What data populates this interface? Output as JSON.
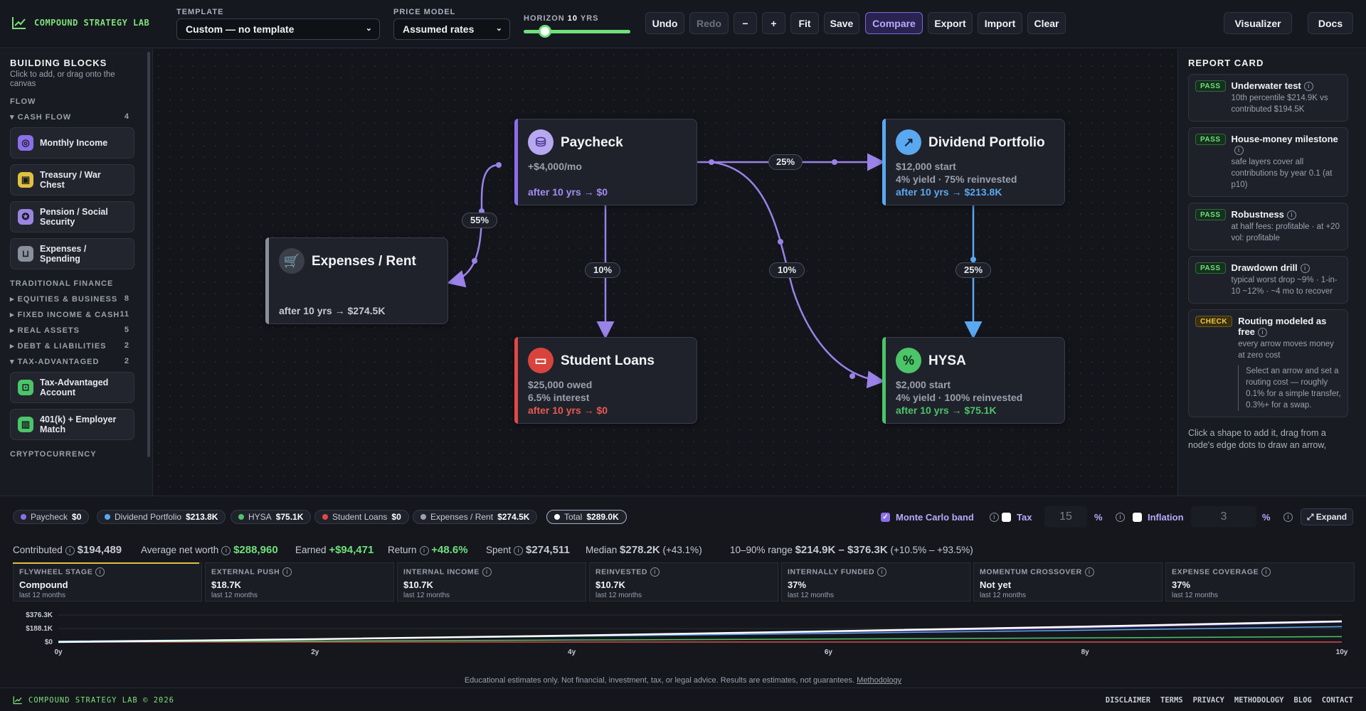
{
  "app": {
    "brand": "COMPOUND STRATEGY LAB"
  },
  "toolbar": {
    "template_label": "TEMPLATE",
    "template_value": "Custom — no template",
    "price_label": "PRICE MODEL",
    "price_value": "Assumed rates",
    "horizon_label": "HORIZON",
    "horizon_value": "10",
    "horizon_unit": "YRS",
    "horizon_fraction": 0.2,
    "buttons": [
      "Undo",
      "Redo",
      "−",
      "+",
      "Fit",
      "Save",
      "Compare",
      "Export",
      "Import",
      "Clear"
    ],
    "visualizer": "Visualizer",
    "docs": "Docs"
  },
  "sidebar": {
    "title": "BUILDING BLOCKS",
    "subtitle": "Click to add, or drag onto the canvas",
    "flow": "FLOW",
    "cash_flow": {
      "label": "CASH FLOW",
      "count": "4"
    },
    "blocks": [
      {
        "label": "Monthly Income",
        "icon": "coin-stack-icon",
        "color": "#8b6fe8"
      },
      {
        "label": "Treasury / War Chest",
        "icon": "safe-icon",
        "color": "#e0c040"
      },
      {
        "label": "Pension / Social Security",
        "icon": "award-icon",
        "color": "#9a86e0"
      },
      {
        "label": "Expenses / Spending",
        "icon": "cart-icon",
        "color": "#8a8f9c"
      }
    ],
    "trad": "TRADITIONAL FINANCE",
    "cats": [
      {
        "label": "EQUITIES & BUSINESS",
        "count": "8"
      },
      {
        "label": "FIXED INCOME & CASH",
        "count": "11"
      },
      {
        "label": "REAL ASSETS",
        "count": "5"
      },
      {
        "label": "DEBT & LIABILITIES",
        "count": "2"
      }
    ],
    "tax": {
      "label": "TAX-ADVANTAGED",
      "count": "2"
    },
    "tax_blocks": [
      {
        "label": "Tax-Advantaged Account",
        "icon": "lock-icon",
        "color": "#4cc46a"
      },
      {
        "label": "401(k) + Employer Match",
        "icon": "building-icon",
        "color": "#4cc46a"
      }
    ],
    "crypto": "CRYPTOCURRENCY"
  },
  "nodes": {
    "paycheck": {
      "title": "Paycheck",
      "l1": "+$4,000/mo",
      "l2": "after 10 yrs → $0"
    },
    "expenses": {
      "title": "Expenses / Rent",
      "l2": "after 10 yrs → $274.5K"
    },
    "dividend": {
      "title": "Dividend Portfolio",
      "l1": "$12,000 start",
      "l2": "4% yield · 75% reinvested",
      "l3": "after 10 yrs → $213.8K"
    },
    "loans": {
      "title": "Student Loans",
      "l1": "$25,000 owed",
      "l2": "6.5% interest",
      "l3": "after 10 yrs → $0"
    },
    "hysa": {
      "title": "HYSA",
      "l1": "$2,000 start",
      "l2": "4% yield · 100% reinvested",
      "l3": "after 10 yrs → $75.1K"
    }
  },
  "edges": {
    "e1": "25%",
    "e2": "55%",
    "e3": "10%",
    "e4": "10%",
    "e5": "25%"
  },
  "report": {
    "title": "REPORT CARD",
    "items": [
      {
        "badge": "PASS",
        "title": "Underwater test",
        "desc": "10th percentile $214.9K vs contributed $194.5K"
      },
      {
        "badge": "PASS",
        "title": "House-money milestone",
        "desc": "safe layers cover all contributions by year 0.1 (at p10)"
      },
      {
        "badge": "PASS",
        "title": "Robustness",
        "desc": "at half fees: profitable · at +20 vol: profitable"
      },
      {
        "badge": "PASS",
        "title": "Drawdown drill",
        "desc": "typical worst drop ~9% · 1-in-10 ~12% · ~4 mo to recover"
      },
      {
        "badge": "CHECK",
        "title": "Routing modeled as free",
        "desc": "every arrow moves money at zero cost",
        "note": "Select an arrow and set a routing cost — roughly 0.1% for a simple transfer, 0.3%+ for a swap."
      }
    ],
    "hint": "Click a shape to add it, drag from a node's edge dots to draw an arrow,"
  },
  "chips": [
    {
      "name": "Paycheck",
      "val": "$0",
      "color": "#8b6fe8"
    },
    {
      "name": "Dividend Portfolio",
      "val": "$213.8K",
      "color": "#5aa8f0"
    },
    {
      "name": "HYSA",
      "val": "$75.1K",
      "color": "#4cc46a"
    },
    {
      "name": "Student Loans",
      "val": "$0",
      "color": "#e04848"
    },
    {
      "name": "Expenses / Rent",
      "val": "$274.5K",
      "color": "#9aa0ad"
    },
    {
      "name": "Total",
      "val": "$289.0K",
      "color": "#ffffff"
    }
  ],
  "options": {
    "mc": "Monte Carlo band",
    "tax": "Tax",
    "tax_val": "15",
    "pct": "%",
    "infl": "Inflation",
    "infl_val": "3",
    "expand": "Expand"
  },
  "stats": {
    "contributed_l": "Contributed",
    "contributed": "$194,489",
    "avg_l": "Average net worth",
    "avg": "$288,960",
    "earned_l": "Earned",
    "earned": "+$94,471",
    "return_l": "Return",
    "ret": "+48.6%",
    "spent_l": "Spent",
    "spent": "$274,511",
    "median_l": "Median",
    "median": "$278.2K",
    "median_pct": "(+43.1%)",
    "range_l": "10–90% range",
    "range": "$214.9K – $376.3K",
    "range_pct": "(+10.5% – +93.5%)"
  },
  "cards": [
    {
      "t": "FLYWHEEL STAGE",
      "v": "Compound",
      "s": "last 12 months"
    },
    {
      "t": "EXTERNAL PUSH",
      "v": "$18.7K",
      "s": "last 12 months"
    },
    {
      "t": "INTERNAL INCOME",
      "v": "$10.7K",
      "s": "last 12 months"
    },
    {
      "t": "REINVESTED",
      "v": "$10.7K",
      "s": "last 12 months"
    },
    {
      "t": "INTERNALLY FUNDED",
      "v": "37%",
      "s": "last 12 months"
    },
    {
      "t": "MOMENTUM CROSSOVER",
      "v": "Not yet",
      "s": "last 12 months"
    },
    {
      "t": "EXPENSE COVERAGE",
      "v": "37%",
      "s": "last 12 months"
    }
  ],
  "chart_data": {
    "type": "line",
    "x": [
      0,
      2,
      4,
      6,
      8,
      10
    ],
    "xticks": [
      "0y",
      "2y",
      "4y",
      "6y",
      "8y",
      "10y"
    ],
    "yticks": [
      "$376.3K",
      "$188.1K",
      "$0"
    ],
    "ylim": [
      0,
      376.3
    ],
    "series": [
      {
        "values": [
          0,
          40,
          90,
          150,
          215,
          289
        ],
        "color": "#ffffff"
      },
      {
        "values": [
          0,
          38,
          85,
          140,
          200,
          278
        ],
        "color": "#8b6fe8"
      },
      {
        "values": [
          12,
          40,
          80,
          120,
          165,
          213.8
        ],
        "color": "#5aa8f0"
      },
      {
        "values": [
          2,
          14,
          28,
          42,
          58,
          75.1
        ],
        "color": "#4cc46a"
      },
      {
        "values": [
          0,
          0,
          0,
          0,
          0,
          0
        ],
        "color": "#e04848"
      }
    ]
  },
  "disclaimer": "Educational estimates only. Not financial, investment, tax, or legal advice. Results are estimates, not guarantees.",
  "methodology": "Methodology",
  "footer": {
    "brand": "COMPOUND STRATEGY LAB © 2026",
    "links": [
      "DISCLAIMER",
      "TERMS",
      "PRIVACY",
      "METHODOLOGY",
      "BLOG",
      "CONTACT"
    ]
  }
}
